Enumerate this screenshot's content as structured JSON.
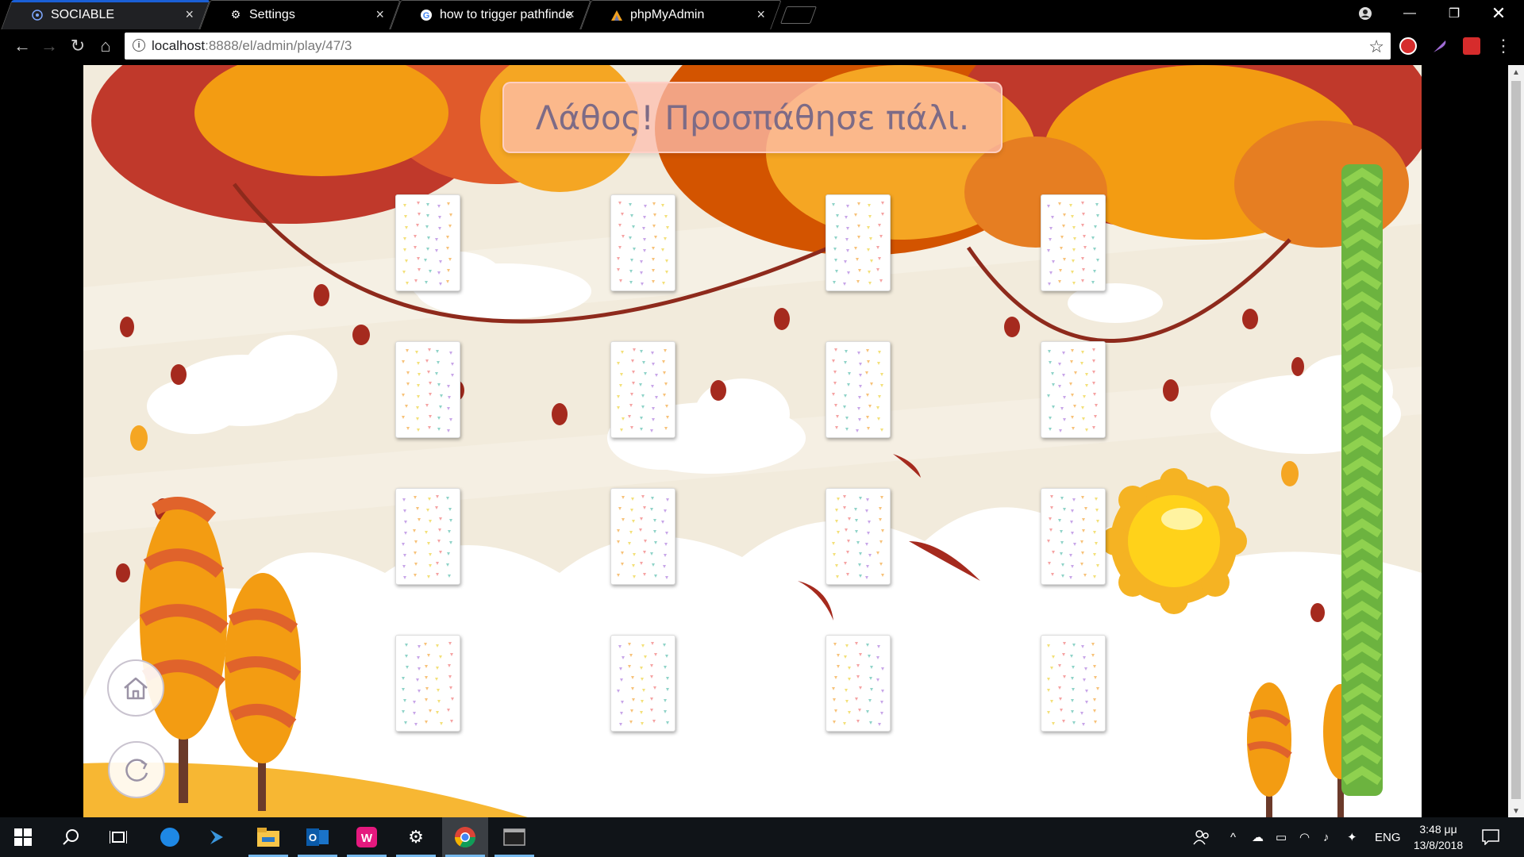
{
  "browser": {
    "tabs": [
      {
        "title": "SOCIABLE",
        "icon": "sociable-logo-icon",
        "active": true
      },
      {
        "title": "Settings",
        "icon": "gear-icon",
        "active": false
      },
      {
        "title": "how to trigger pathfinder",
        "icon": "google-icon",
        "active": false
      },
      {
        "title": "phpMyAdmin",
        "icon": "phpmyadmin-icon",
        "active": false
      }
    ],
    "url_host": "localhost",
    "url_path": ":8888/el/admin/play/47/3"
  },
  "game": {
    "message": "Λάθος! Προσπάθησε πάλι.",
    "grid": {
      "rows": 4,
      "columns": 4
    },
    "cards": [
      {
        "face": "down"
      },
      {
        "face": "down"
      },
      {
        "face": "down"
      },
      {
        "face": "down"
      },
      {
        "face": "down"
      },
      {
        "face": "down"
      },
      {
        "face": "down"
      },
      {
        "face": "down"
      },
      {
        "face": "down"
      },
      {
        "face": "down"
      },
      {
        "face": "down"
      },
      {
        "face": "down"
      },
      {
        "face": "down"
      },
      {
        "face": "down"
      },
      {
        "face": "down"
      },
      {
        "face": "down"
      }
    ],
    "home_button_icon": "home-icon",
    "restart_button_icon": "restart-icon",
    "progress_fraction": 0.0
  },
  "taskbar": {
    "language": "ENG",
    "time": "3:48 μμ",
    "date": "13/8/2018"
  },
  "colors": {
    "banner_text": "#7d6b86",
    "progress_green": "#7cc242",
    "leaf_orange": "#f5a623",
    "leaf_red": "#c1402f"
  }
}
